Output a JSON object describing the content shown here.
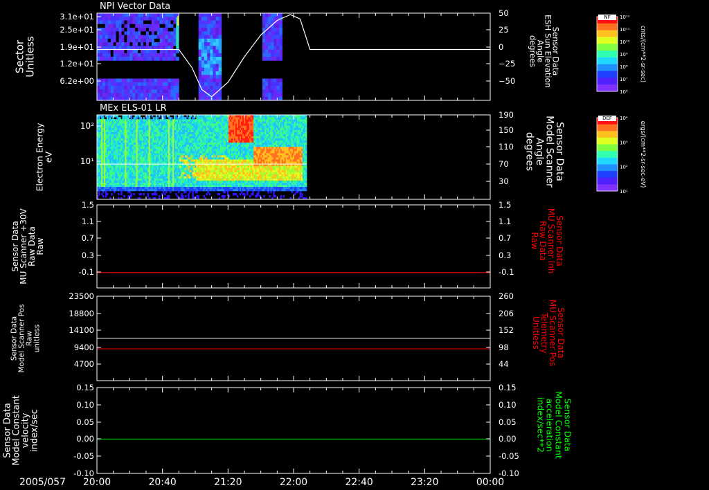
{
  "colors": {
    "bg": "#000000",
    "fg": "#ffffff",
    "red_trace": "#ff0000",
    "green_trace": "#00ff00"
  },
  "date_label": "2005/057",
  "x_axis": {
    "ticks": [
      "20:00",
      "20:40",
      "21:20",
      "22:00",
      "22:40",
      "23:20",
      "00:00"
    ]
  },
  "panels": [
    {
      "id": "npi",
      "title": "NPI Vector Data",
      "left_label": [
        "Sector",
        "Unitless"
      ],
      "left_ticks": [
        "3.1e+01",
        "2.5e+01",
        "1.9e+01",
        "1.2e+01",
        "6.2e+00"
      ],
      "right_label": [
        "Sensor Data",
        "ESH Sun Elevation",
        "Angle",
        "degrees"
      ],
      "right_ticks": [
        "50",
        "25",
        "0",
        "−25",
        "−50"
      ],
      "colorbar": {
        "title": "NF",
        "ticks": [
          "10¹²",
          "10¹¹",
          "10¹⁰",
          "10⁹",
          "10⁸",
          "10⁷",
          "10⁶"
        ],
        "unit": "cnts/(cm**2-sr-sec)"
      }
    },
    {
      "id": "els",
      "title": "MEx ELS-01 LR",
      "left_label": [
        "Electron Energy",
        "eV"
      ],
      "left_ticks": [
        "10²",
        "10¹"
      ],
      "right_label": [
        "Sensor Data",
        "Model Scanner",
        "Angle",
        "degrees"
      ],
      "right_ticks": [
        "190",
        "150",
        "110",
        "70",
        "30"
      ],
      "colorbar": {
        "title": "DEF",
        "ticks": [
          "10⁴",
          "10³",
          "10²",
          "10¹"
        ],
        "unit": "ergs/(cm**2-sr-sec-eV)"
      }
    },
    {
      "id": "mu-raw",
      "left_label": [
        "Sensor Data",
        "MU Scanner +30V",
        "Raw Data",
        "Raw"
      ],
      "left_ticks": [
        "1.5",
        "1.1",
        "0.7",
        "0.3",
        "-0.1"
      ],
      "right_label": [
        "Sensor Data",
        "MU Scanner Inh",
        "Raw Data",
        "Raw"
      ],
      "right_ticks": [
        "1.5",
        "1.1",
        "0.7",
        "0.3",
        "-0.1"
      ]
    },
    {
      "id": "scanner-pos",
      "left_label": [
        "Sensor Data",
        "Model Scanner Pos",
        "Raw",
        "unitless"
      ],
      "left_ticks": [
        "23500",
        "18800",
        "14100",
        "9400",
        "4700"
      ],
      "right_label": [
        "Sensor Data",
        "MU Scanner Pos",
        "Telemetry",
        "Unitless"
      ],
      "right_ticks": [
        "260",
        "206",
        "152",
        "98",
        "44"
      ]
    },
    {
      "id": "model-constant",
      "left_label": [
        "Sensor Data",
        "Model Constant",
        "velocity",
        "index/sec"
      ],
      "left_ticks": [
        "0.15",
        "0.10",
        "0.05",
        "0.00",
        "-0.05",
        "-0.10"
      ],
      "right_label": [
        "Sensor Data",
        "Model Constant",
        "acceleration",
        "index/sec**2"
      ],
      "right_ticks": [
        "0.15",
        "0.10",
        "0.05",
        "0.00",
        "-0.05",
        "-0.10"
      ]
    }
  ],
  "chart_data": [
    {
      "type": "heatmap",
      "title": "NPI Vector Data",
      "x_range": [
        "2005/057 20:00",
        "2005/058 00:00"
      ],
      "y_label": "Sector Unitless",
      "y_ticks": [
        31,
        25,
        19,
        12,
        6.2
      ],
      "data_blocks": [
        {
          "start": "20:00",
          "end": "20:50",
          "fill": "purple-blue spectrogram, cyan/green edge at 20:48",
          "gap_sector": "12-16"
        },
        {
          "start": "21:02",
          "end": "21:16",
          "fill": "blue spectrogram with cyan core"
        },
        {
          "start": "21:41",
          "end": "21:53",
          "fill": "purple-blue spectrogram",
          "gap_sector": "12-16"
        }
      ],
      "overlay_series": {
        "name": "ESH Sun Elevation Angle",
        "axis": "right",
        "unit": "degrees",
        "x": [
          "20:00",
          "20:50",
          "20:58",
          "21:04",
          "21:10",
          "21:20",
          "21:30",
          "21:40",
          "21:50",
          "21:58",
          "22:04",
          "22:10",
          "00:00"
        ],
        "y": [
          0,
          0,
          -25,
          -55,
          -65,
          -45,
          -10,
          20,
          40,
          48,
          42,
          0,
          0
        ]
      },
      "right_ylim": [
        -70,
        50
      ]
    },
    {
      "type": "heatmap",
      "title": "MEx ELS-01 LR",
      "x_range": [
        "20:00",
        "22:08"
      ],
      "y_label": "Electron Energy eV",
      "y_scale": "log",
      "ylim_eV": [
        3,
        200
      ],
      "highlights": [
        {
          "start": "21:20",
          "end": "21:35",
          "energy_eV": [
            60,
            200
          ],
          "level": "red (high)"
        },
        {
          "start": "21:35",
          "end": "22:05",
          "energy_eV": [
            15,
            40
          ],
          "level": "orange-red band"
        }
      ],
      "overlay_series": {
        "name": "Model Scanner Angle",
        "axis": "right",
        "unit": "degrees",
        "x": [
          "20:00",
          "22:08"
        ],
        "y": [
          85,
          85
        ]
      },
      "right_ylim": [
        10,
        190
      ]
    },
    {
      "type": "line",
      "series": [
        {
          "name": "MU Scanner +30V Raw Data",
          "axis": "left",
          "color": "#ff0000",
          "x": [
            "20:00",
            "00:00"
          ],
          "y": [
            -0.05,
            -0.05
          ]
        },
        {
          "name": "MU Scanner Inh Raw Data",
          "axis": "right",
          "color": "#ff0000",
          "x": [
            "20:00",
            "00:00"
          ],
          "y": [
            -0.05,
            -0.05
          ]
        }
      ],
      "ylim": [
        -0.4,
        1.5
      ]
    },
    {
      "type": "line",
      "series": [
        {
          "name": "Model Scanner Pos Raw",
          "axis": "left",
          "color": "#ffffff",
          "x": [
            "20:00",
            "00:00"
          ],
          "y": [
            11800,
            11800
          ]
        },
        {
          "name": "MU Scanner Pos Telemetry",
          "axis": "right",
          "color": "#ff0000",
          "x": [
            "20:00",
            "00:00"
          ],
          "y": [
            98,
            98
          ]
        }
      ],
      "ylim_left": [
        0,
        23500
      ],
      "ylim_right": [
        0,
        260
      ]
    },
    {
      "type": "line",
      "series": [
        {
          "name": "Model Constant acceleration",
          "axis": "right",
          "color": "#00ff00",
          "x": [
            "20:00",
            "00:00"
          ],
          "y": [
            0.0,
            0.0
          ]
        }
      ],
      "ylim": [
        -0.1,
        0.15
      ]
    }
  ]
}
